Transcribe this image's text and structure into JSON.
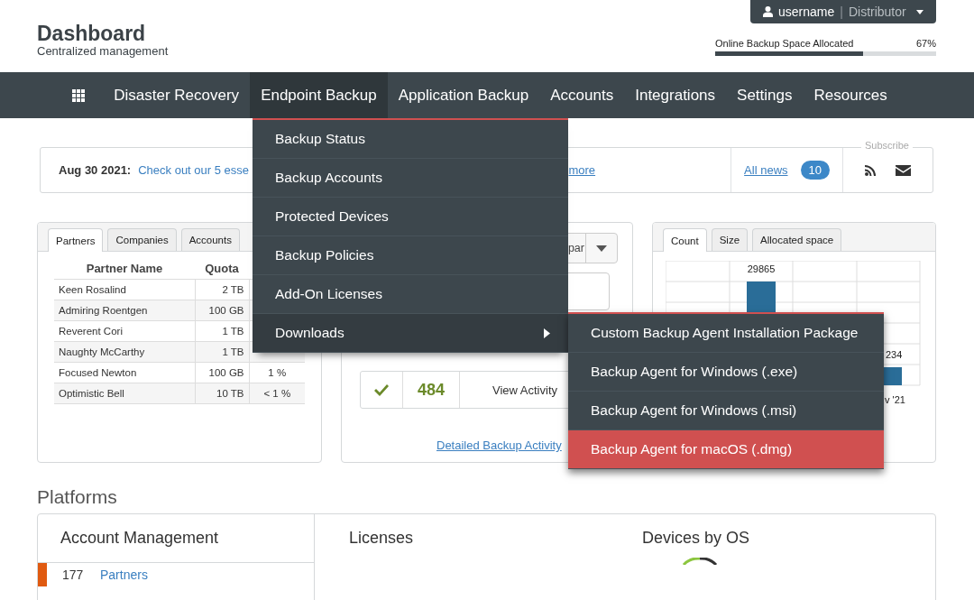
{
  "header": {
    "title": "Dashboard",
    "subtitle": "Centralized management",
    "user": {
      "name": "username",
      "separator": "|",
      "role": "Distributor"
    },
    "usage": {
      "label": "Online Backup Space Allocated",
      "reading": "67%",
      "level": 0.67
    }
  },
  "nav": [
    {
      "label": "Disaster Recovery",
      "selected": false
    },
    {
      "label": "Endpoint Backup",
      "selected": true
    },
    {
      "label": "Application Backup",
      "selected": false
    },
    {
      "label": "Accounts",
      "selected": false
    },
    {
      "label": "Integrations",
      "selected": false
    },
    {
      "label": "Settings",
      "selected": false
    },
    {
      "label": "Resources",
      "selected": false
    }
  ],
  "news": {
    "date": "Aug 30 2021:",
    "link_start": "Check out our 5 esse",
    "link_end": "more",
    "all_news": "All news",
    "count": "10",
    "subscribe": "Subscribe"
  },
  "partners_panel": {
    "tabs": [
      {
        "label": "Partners",
        "selected": true
      },
      {
        "label": "Companies",
        "selected": false
      },
      {
        "label": "Accounts",
        "selected": false
      }
    ],
    "columns": [
      "Partner Name",
      "Quota"
    ],
    "rows": [
      {
        "name": "Keen Rosalind",
        "quota": "2 TB"
      },
      {
        "name": "Admiring Roentgen",
        "quota": "100 GB"
      },
      {
        "name": "Reverent Cori",
        "quota": "1 TB"
      },
      {
        "name": "Naughty McCarthy",
        "quota": "1 TB"
      },
      {
        "name": "Focused Newton",
        "quota": "100 GB",
        "column_3": "1 %"
      },
      {
        "name": "Optimistic Bell",
        "quota": "10 TB",
        "column_3": "< 1 %"
      }
    ]
  },
  "activity_panel": {
    "select_value": "par",
    "count": "484",
    "action": "View Activity",
    "link": "Detailed Backup Activity"
  },
  "storage_panel": {
    "tabs": [
      {
        "label": "Count",
        "selected": true
      },
      {
        "label": "Size",
        "selected": false
      },
      {
        "label": "Allocated space",
        "selected": false
      }
    ],
    "bar_labels": [
      "29865",
      "234"
    ],
    "x_label": "v '21"
  },
  "platforms": {
    "title": "Platforms",
    "account_title": "Account Management",
    "account_rows": [
      {
        "count": "177",
        "label": "Partners",
        "color": "#e05a10"
      }
    ],
    "licenses_title": "Licenses",
    "devices_title": "Devices by OS"
  },
  "menu": [
    {
      "label": "Backup Status",
      "expanded": false
    },
    {
      "label": "Backup Accounts",
      "expanded": false
    },
    {
      "label": "Protected Devices",
      "expanded": false
    },
    {
      "label": "Backup Policies",
      "expanded": false
    },
    {
      "label": "Add-On Licenses",
      "expanded": false
    },
    {
      "label": "Downloads",
      "expanded": true,
      "submenu": true
    }
  ],
  "submenu": [
    {
      "label": "Custom Backup Agent Installation Package",
      "selected": false
    },
    {
      "label": "Backup Agent for Windows (.exe)",
      "selected": false
    },
    {
      "label": "Backup Agent for Windows (.msi)",
      "selected": false
    },
    {
      "label": "Backup Agent for macOS (.dmg)",
      "selected": true
    }
  ]
}
